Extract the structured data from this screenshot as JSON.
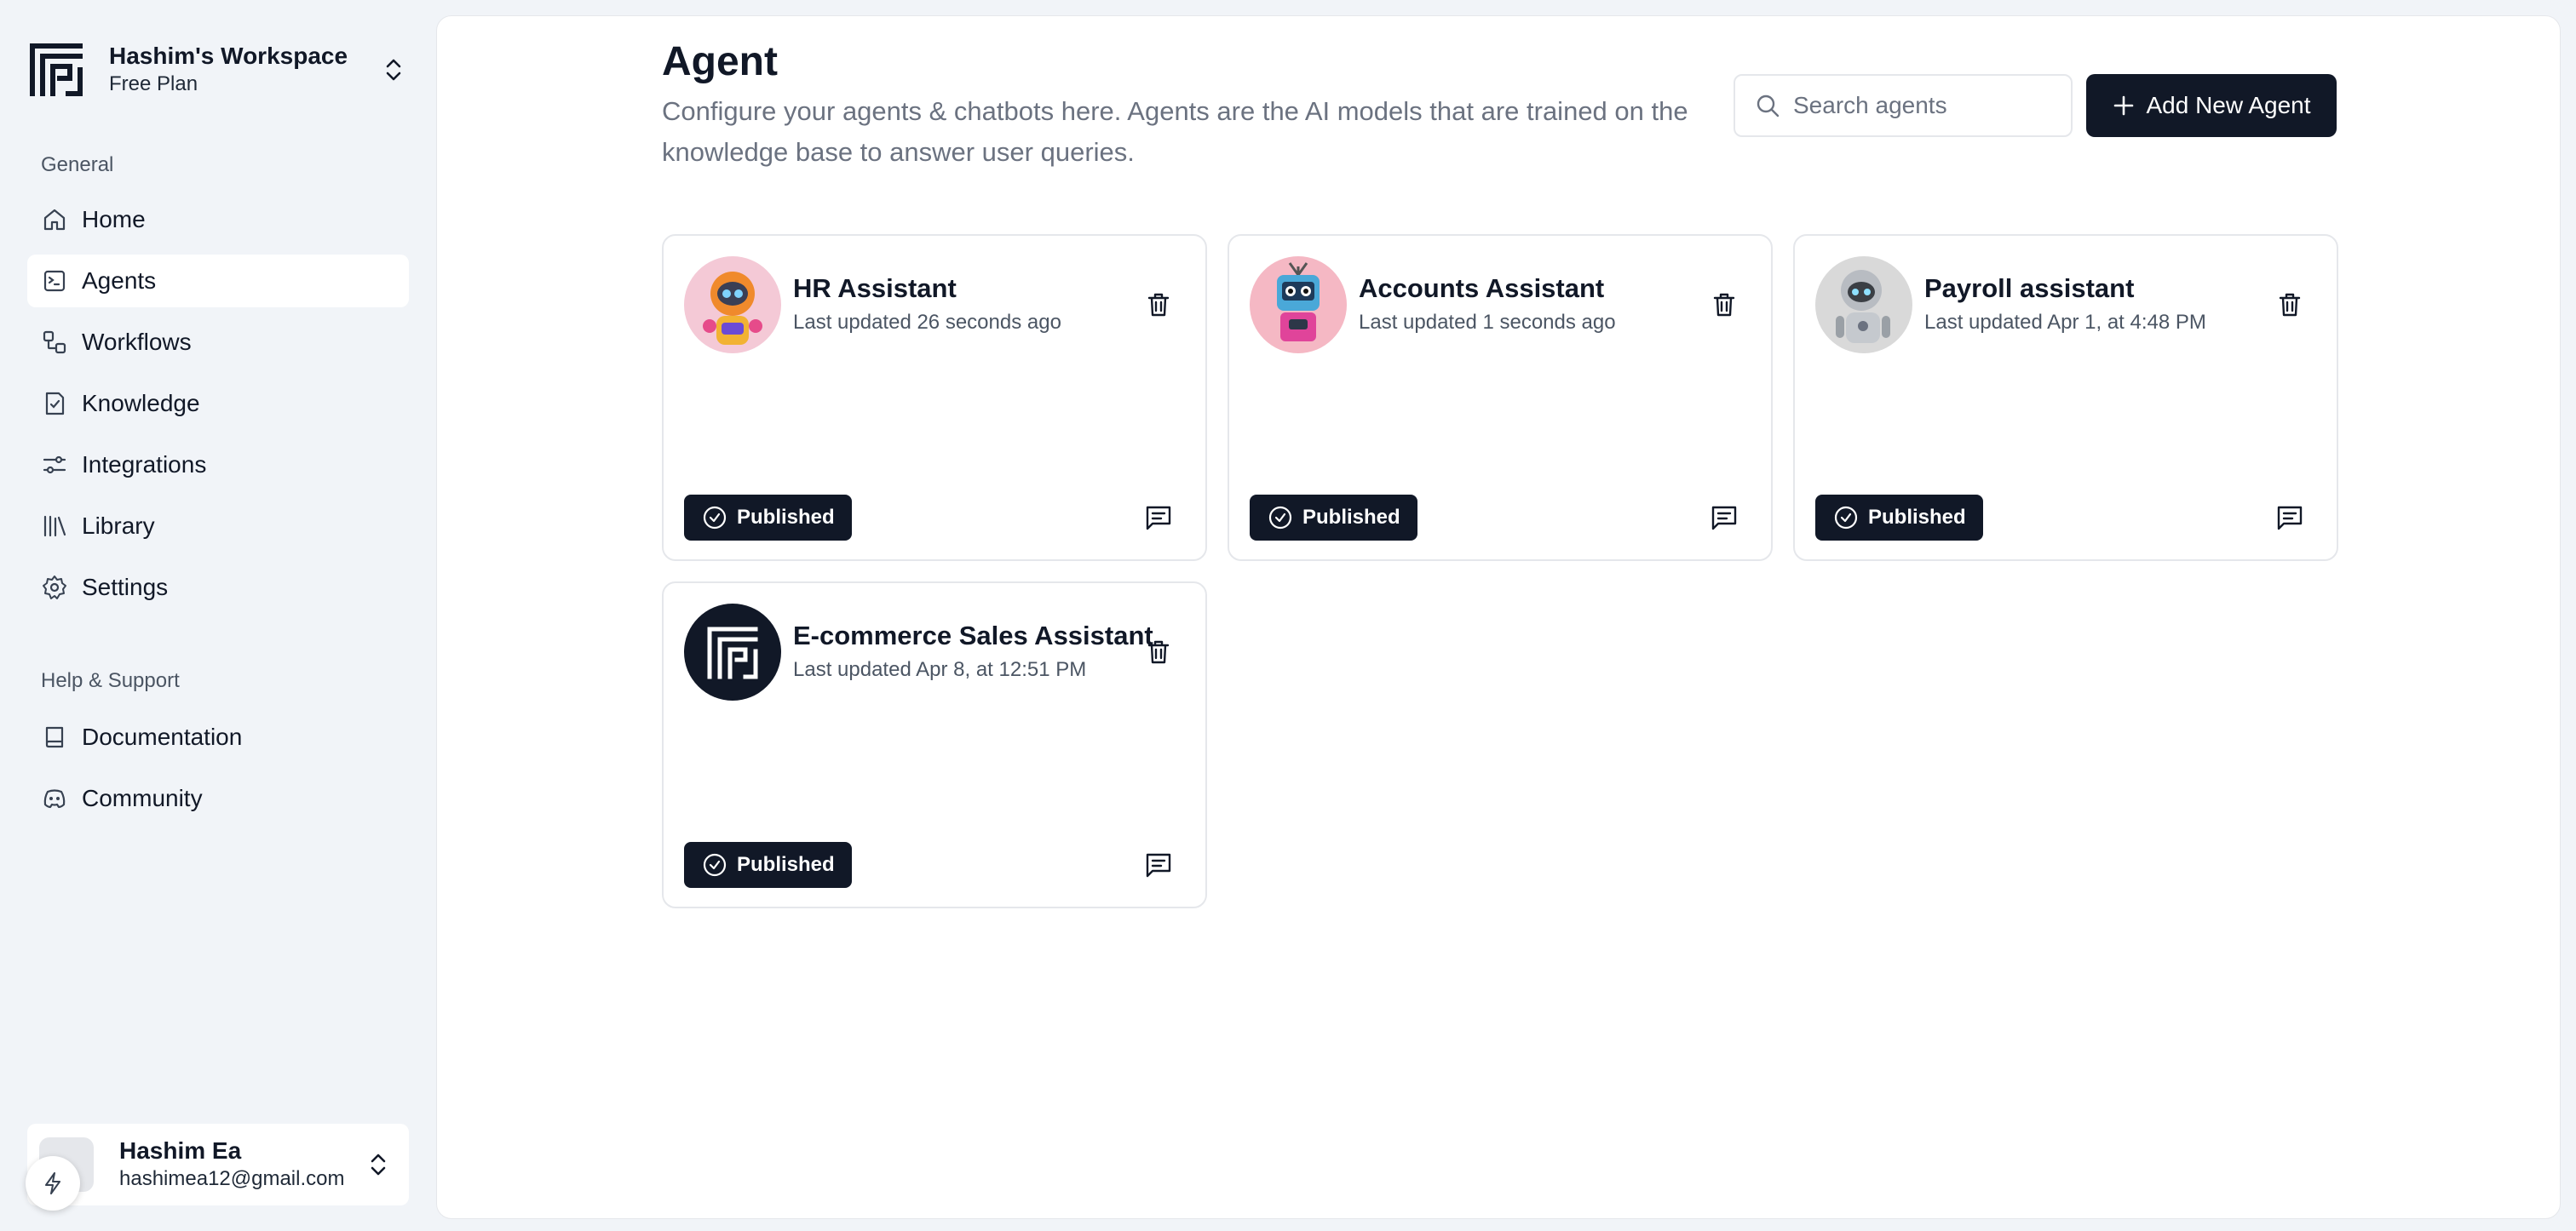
{
  "workspace": {
    "name": "Hashim's Workspace",
    "plan": "Free Plan"
  },
  "sidebar": {
    "general_label": "General",
    "items": [
      {
        "label": "Home",
        "icon": "home-icon"
      },
      {
        "label": "Agents",
        "icon": "agents-icon",
        "active": true
      },
      {
        "label": "Workflows",
        "icon": "workflows-icon"
      },
      {
        "label": "Knowledge",
        "icon": "knowledge-icon"
      },
      {
        "label": "Integrations",
        "icon": "integrations-icon"
      },
      {
        "label": "Library",
        "icon": "library-icon"
      },
      {
        "label": "Settings",
        "icon": "settings-icon"
      }
    ],
    "support_label": "Help & Support",
    "support_items": [
      {
        "label": "Documentation",
        "icon": "book-icon"
      },
      {
        "label": "Community",
        "icon": "discord-icon"
      }
    ]
  },
  "user": {
    "name": "Hashim Ea",
    "email": "hashimea12@gmail.com"
  },
  "page": {
    "title": "Agent",
    "description": "Configure your agents & chatbots here. Agents are the AI models that are trained on the knowledge base to answer user queries.",
    "search_placeholder": "Search agents",
    "add_button": "Add New Agent"
  },
  "agents": [
    {
      "name": "HR Assistant",
      "updated": "Last updated 26 seconds ago",
      "status": "Published",
      "avatar": "robot-orange"
    },
    {
      "name": "Accounts Assistant",
      "updated": "Last updated 1 seconds ago",
      "status": "Published",
      "avatar": "robot-blue"
    },
    {
      "name": "Payroll assistant",
      "updated": "Last updated Apr 1, at 4:48 PM",
      "status": "Published",
      "avatar": "robot-silver"
    },
    {
      "name": "E-commerce Sales Assistant",
      "updated": "Last updated Apr 8, at 12:51 PM",
      "status": "Published",
      "avatar": "logo-dark"
    }
  ],
  "colors": {
    "accent": "#111827",
    "background": "#f1f4f8",
    "panel": "#ffffff"
  }
}
